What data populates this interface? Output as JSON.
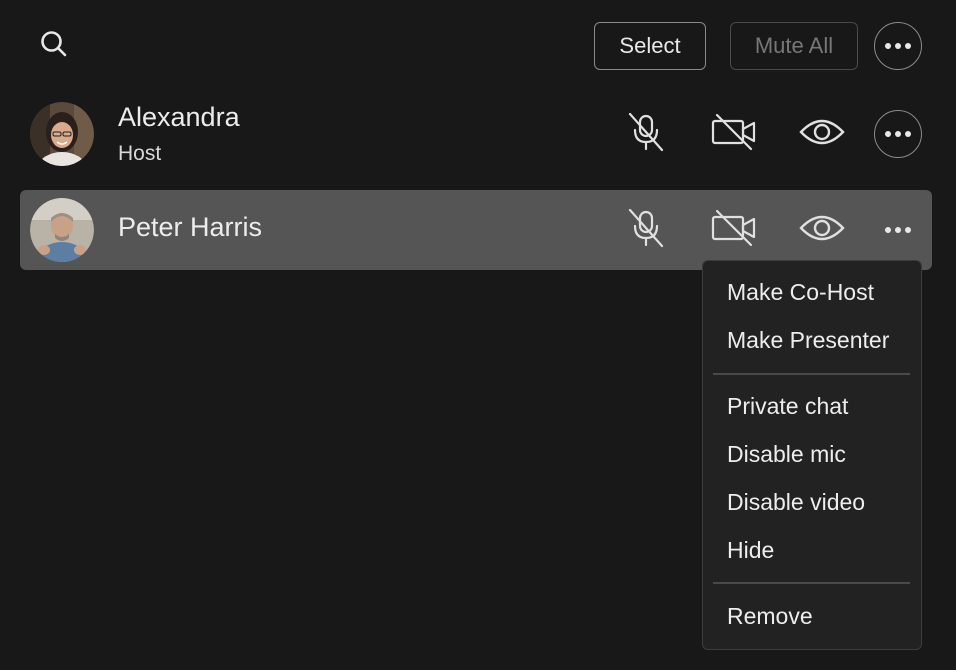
{
  "toolbar": {
    "search_icon": "search-icon",
    "select_label": "Select",
    "mute_all_label": "Mute All",
    "more_icon": "more-horizontal-icon"
  },
  "participants": [
    {
      "name": "Alexandra",
      "role": "Host",
      "mic": "muted",
      "video": "off",
      "view": "visible"
    },
    {
      "name": "Peter Harris",
      "role": "",
      "mic": "muted",
      "video": "off",
      "view": "visible",
      "highlighted": true
    }
  ],
  "context_menu": {
    "groups": [
      [
        "Make Co-Host",
        "Make Presenter"
      ],
      [
        "Private chat",
        "Disable mic",
        "Disable video",
        "Hide"
      ],
      [
        "Remove"
      ]
    ]
  },
  "colors": {
    "background": "#181818",
    "row_highlight": "#555555",
    "menu_background": "#222222",
    "icon": "#e0e0e0"
  }
}
